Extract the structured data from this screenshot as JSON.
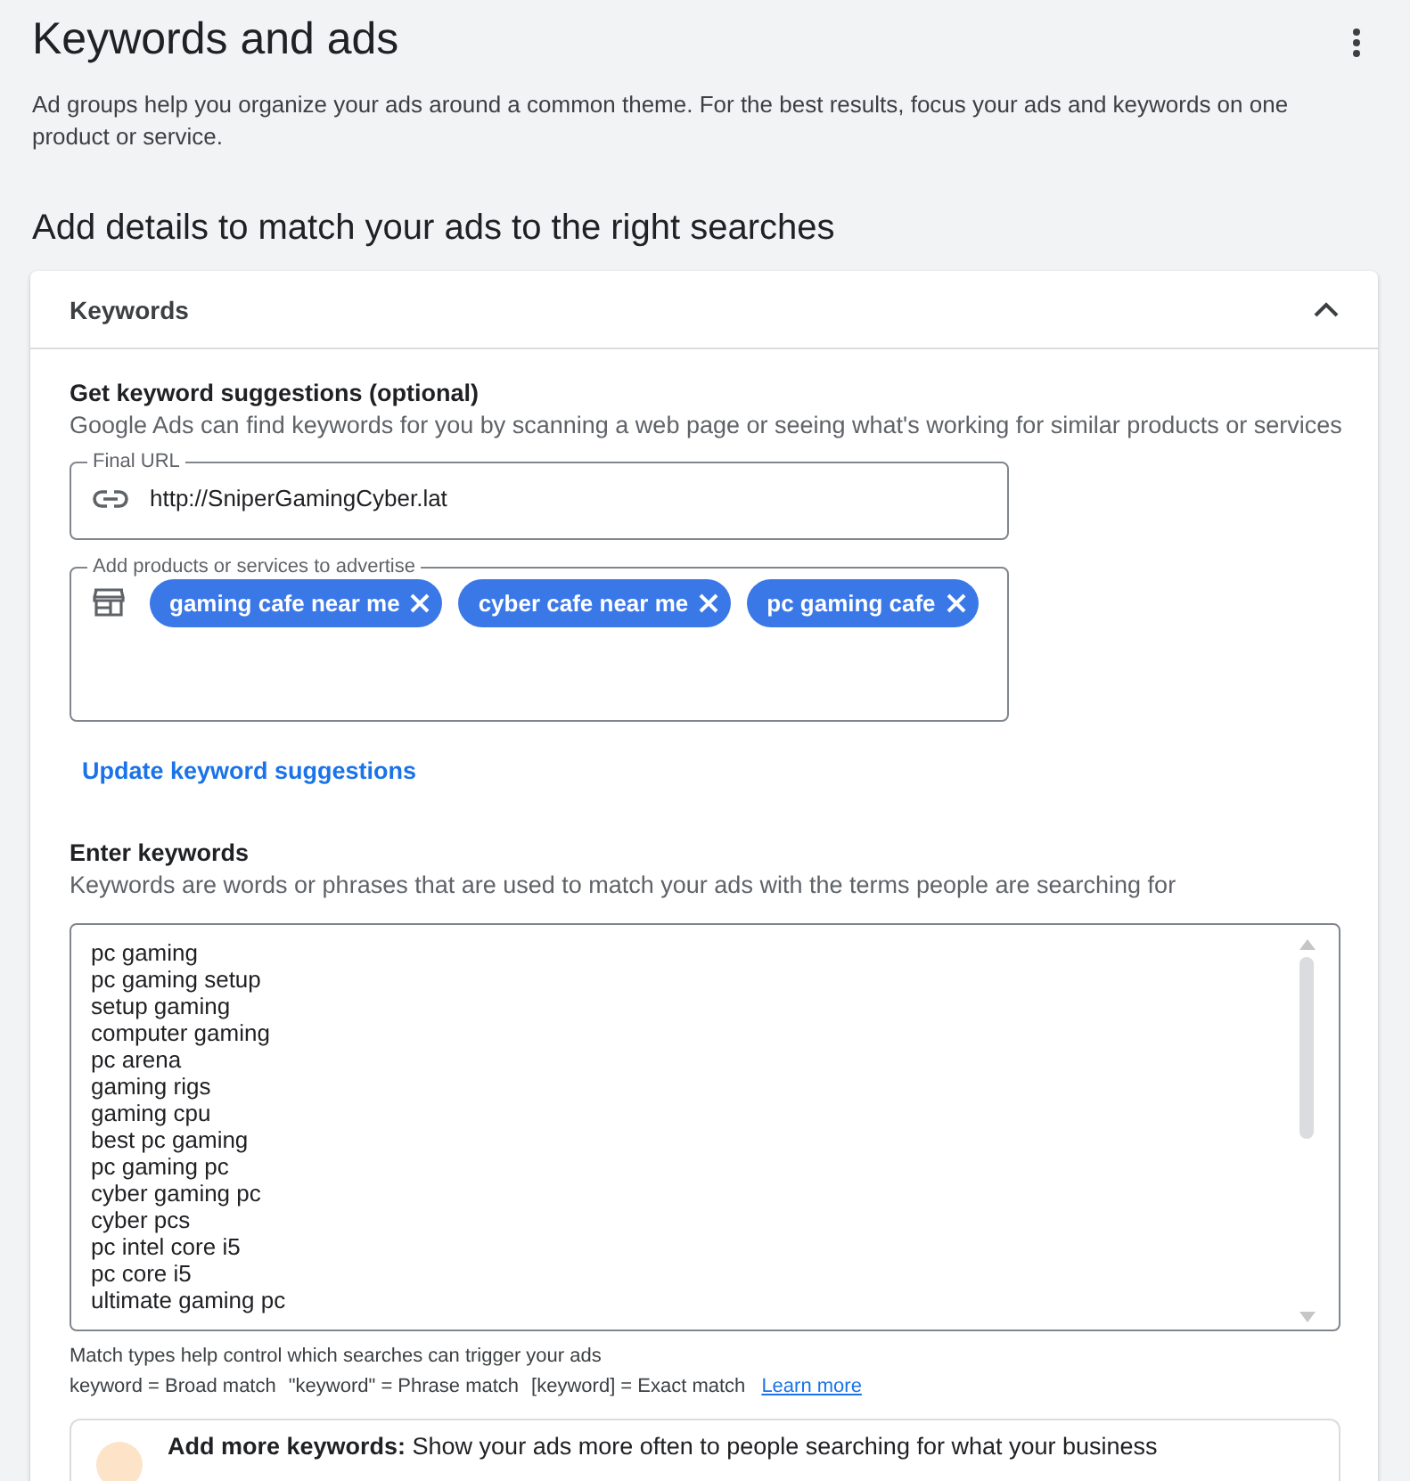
{
  "page": {
    "title": "Keywords and ads",
    "description": "Ad groups help you organize your ads around a common theme. For the best results, focus your ads and keywords on one product or service."
  },
  "section_title": "Add details to match your ads to the right searches",
  "keywords_panel": {
    "title": "Keywords",
    "expanded": true,
    "suggestions": {
      "heading": "Get keyword suggestions (optional)",
      "description": "Google Ads can find keywords for you by scanning a web page or seeing what's working for similar products or services",
      "final_url": {
        "label": "Final URL",
        "value": "http://SniperGamingCyber.lat"
      },
      "products": {
        "label": "Add products or services to advertise",
        "chips": [
          "gaming cafe near me",
          "cyber cafe near me",
          "pc gaming cafe"
        ]
      },
      "update_link": "Update keyword suggestions"
    },
    "enter_keywords": {
      "heading": "Enter keywords",
      "description": "Keywords are words or phrases that are used to match your ads with the terms people are searching for",
      "keywords": [
        "pc gaming",
        "pc gaming setup",
        "setup gaming",
        "computer gaming",
        "pc arena",
        "gaming rigs",
        "gaming cpu",
        "best pc gaming",
        "pc gaming pc",
        "cyber gaming pc",
        "cyber pcs",
        "pc intel core i5",
        "pc core i5",
        "ultimate gaming pc"
      ],
      "match_hint": "Match types help control which searches can trigger your ads",
      "match_types": [
        "keyword = Broad match",
        "\"keyword\" = Phrase match",
        "[keyword] = Exact match"
      ],
      "learn_more": "Learn more"
    },
    "tip": {
      "text": "**Add more keywords:** Show your ads more often to people searching for what your business"
    }
  }
}
